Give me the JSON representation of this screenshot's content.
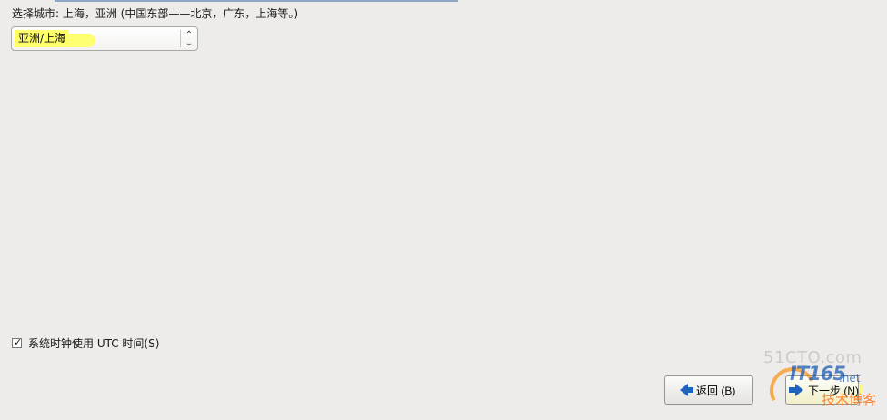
{
  "city_selection": {
    "label": "选择城市: 上海，亚洲 (中国东部——北京，广东，上海等。)",
    "selected_city": "亚洲/上海",
    "control_icon": "up-down-spinner-icon"
  },
  "clock_setting": {
    "checked": true,
    "label": "系统时钟使用 UTC 时间(S)"
  },
  "navigation": {
    "back_label": "返回 (B)",
    "next_label": "下一步 (N)",
    "back_icon": "arrow-left-icon",
    "next_icon": "arrow-right-icon"
  },
  "watermark": {
    "logo_text": "IT165",
    "faint_text": "51CTO.com",
    "net_text": ".net",
    "sub_text": "技术博客"
  },
  "colors": {
    "background": "#edecea",
    "highlight": "#ffff6a",
    "accent": "#1f63bf"
  }
}
